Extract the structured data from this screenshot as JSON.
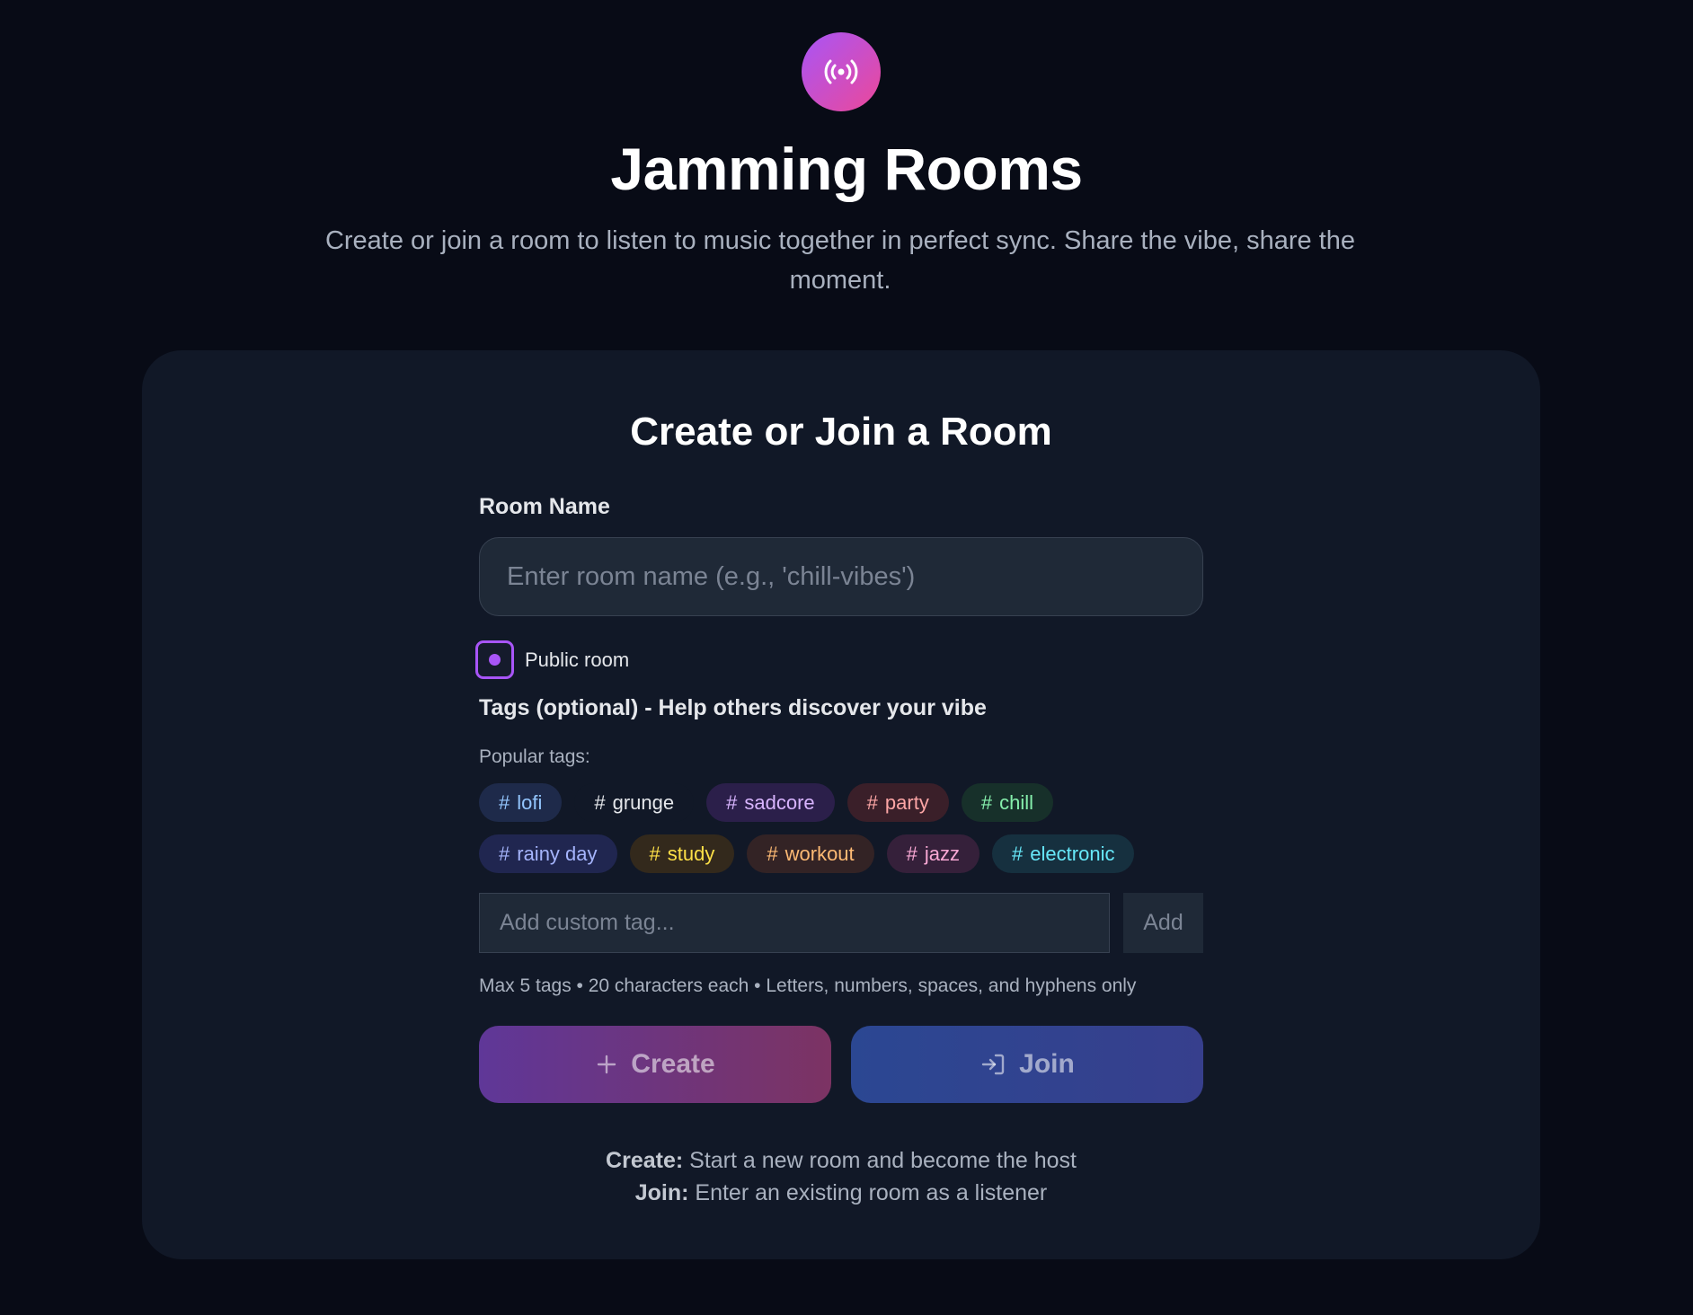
{
  "header": {
    "logo_icon": "broadcast-icon",
    "title": "Jamming Rooms",
    "subtitle": "Create or join a room to listen to music together in perfect sync. Share the vibe, share the moment."
  },
  "card": {
    "title": "Create or Join a Room",
    "room_name": {
      "label": "Room Name",
      "value": "",
      "placeholder": "Enter room name (e.g., 'chill-vibes')"
    },
    "public_room": {
      "label": "Public room",
      "checked": true
    },
    "tags": {
      "heading": "Tags (optional) - Help others discover your vibe",
      "popular_label": "Popular tags:",
      "hash": "#",
      "popular": [
        {
          "label": "lofi",
          "color": "#93c5fd",
          "bg": "#1e2a4a"
        },
        {
          "label": "grunge",
          "color": "#e5e7eb",
          "bg": "#111827"
        },
        {
          "label": "sadcore",
          "color": "#d8b4fe",
          "bg": "#2b1f4a"
        },
        {
          "label": "party",
          "color": "#fca5a5",
          "bg": "#3a1f29"
        },
        {
          "label": "chill",
          "color": "#86efac",
          "bg": "#17302a"
        },
        {
          "label": "rainy day",
          "color": "#a5b4fc",
          "bg": "#202650"
        },
        {
          "label": "study",
          "color": "#fde047",
          "bg": "#33291c"
        },
        {
          "label": "workout",
          "color": "#fdba74",
          "bg": "#332325"
        },
        {
          "label": "jazz",
          "color": "#f9a8d4",
          "bg": "#35203a"
        },
        {
          "label": "electronic",
          "color": "#67e8f9",
          "bg": "#16303f"
        }
      ],
      "custom_input": {
        "value": "",
        "placeholder": "Add custom tag..."
      },
      "add_label": "Add",
      "hint": "Max 5 tags • 20 characters each • Letters, numbers, spaces, and hyphens only"
    },
    "actions": {
      "create_label": "Create",
      "create_icon": "plus-icon",
      "join_label": "Join",
      "join_icon": "sign-in-icon"
    },
    "footnote": {
      "create_term": "Create:",
      "create_desc": " Start a new room and become the host",
      "join_term": "Join:",
      "join_desc": " Enter an existing room as a listener"
    }
  },
  "colors": {
    "page_bg": "#080b16",
    "card_bg": "#111827",
    "accent_purple": "#a855f7",
    "accent_pink": "#ec4899"
  }
}
